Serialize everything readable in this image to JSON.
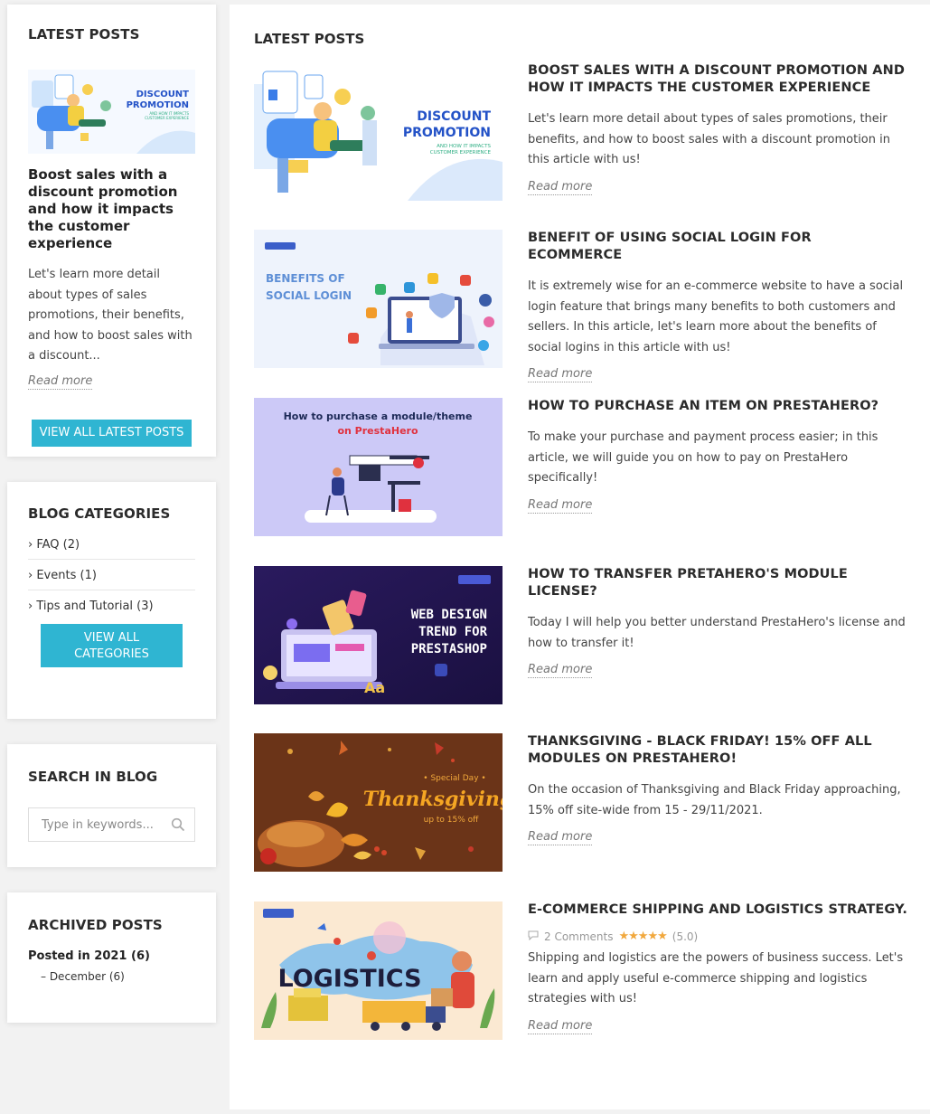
{
  "sidebar": {
    "latest": {
      "heading": "LATEST POSTS",
      "thumb_line1": "DISCOUNT",
      "thumb_line2": "PROMOTION",
      "thumb_line3": "AND HOW IT IMPACTS",
      "thumb_line4": "CUSTOMER EXPERIENCE",
      "title": "Boost sales with a discount promotion and how it impacts the customer experience",
      "desc": "Let's learn more detail about types of sales promotions, their benefits, and how to boost sales with a discount...",
      "read_more": "Read more",
      "button": "VIEW ALL LATEST POSTS"
    },
    "categories": {
      "heading": "BLOG CATEGORIES",
      "items": [
        {
          "label": "FAQ (2)"
        },
        {
          "label": "Events (1)"
        },
        {
          "label": "Tips and Tutorial (3)"
        }
      ],
      "button_line1": "VIEW ALL",
      "button_line2": "CATEGORIES"
    },
    "search": {
      "heading": "SEARCH IN BLOG",
      "placeholder": "Type in keywords..."
    },
    "archive": {
      "heading": "ARCHIVED POSTS",
      "year": "Posted in 2021 (6)",
      "month": "– December (6)"
    }
  },
  "main": {
    "heading": "LATEST POSTS",
    "read_more": "Read more",
    "posts": [
      {
        "title": "BOOST SALES WITH A DISCOUNT PROMOTION AND HOW IT IMPACTS THE CUSTOMER EXPERIENCE",
        "desc": "Let's learn more detail about types of sales promotions, their benefits, and how to boost sales with a discount promotion in this article with us!",
        "img_line1": "DISCOUNT",
        "img_line2": "PROMOTION",
        "img_line3": "AND HOW IT IMPACTS",
        "img_line4": "CUSTOMER EXPERIENCE"
      },
      {
        "title": "BENEFIT OF USING SOCIAL LOGIN FOR ECOMMERCE",
        "desc": "It is extremely wise for an e-commerce website to have a social login feature that brings many benefits to both customers and sellers. In this article, let's learn more about the benefits of social logins in this article with us!",
        "img_line1": "BENEFITS OF",
        "img_line2": "SOCIAL LOGIN"
      },
      {
        "title": "HOW TO PURCHASE AN ITEM ON PRESTAHERO?",
        "desc": "To make your purchase and payment process easier; in this article, we will guide you on how to pay on PrestaHero specifically!",
        "img_line1": "How to purchase a module/theme",
        "img_line2": "on PrestaHero"
      },
      {
        "title": "HOW TO TRANSFER PRETAHERO'S MODULE LICENSE?",
        "desc": "Today I will help you better understand PrestaHero's license and how to transfer it!",
        "img_line1": "WEB DESIGN",
        "img_line2": "TREND FOR",
        "img_line3": "PRESTASHOP"
      },
      {
        "title": "THANKSGIVING - BLACK FRIDAY! 15% OFF ALL MODULES ON PRESTAHERO!",
        "desc": "On the occasion of Thanksgiving and Black Friday approaching, 15% off site-wide from 15 - 29/11/2021.",
        "img_line1": "• Special Day •",
        "img_line2": "Thanksgiving",
        "img_line3": "up to 15% off"
      },
      {
        "title": "E-COMMERCE SHIPPING AND LOGISTICS STRATEGY.",
        "desc": "Shipping and logistics are the powers of business success. Let's learn and apply useful e-commerce shipping and logistics strategies with us!",
        "img_line1": "LOGISTICS",
        "comments": "2 Comments",
        "stars": "★★★★★",
        "rating": "(5.0)"
      }
    ]
  },
  "colors": {
    "accent": "#2fb5d2",
    "star": "#f1a83d"
  }
}
